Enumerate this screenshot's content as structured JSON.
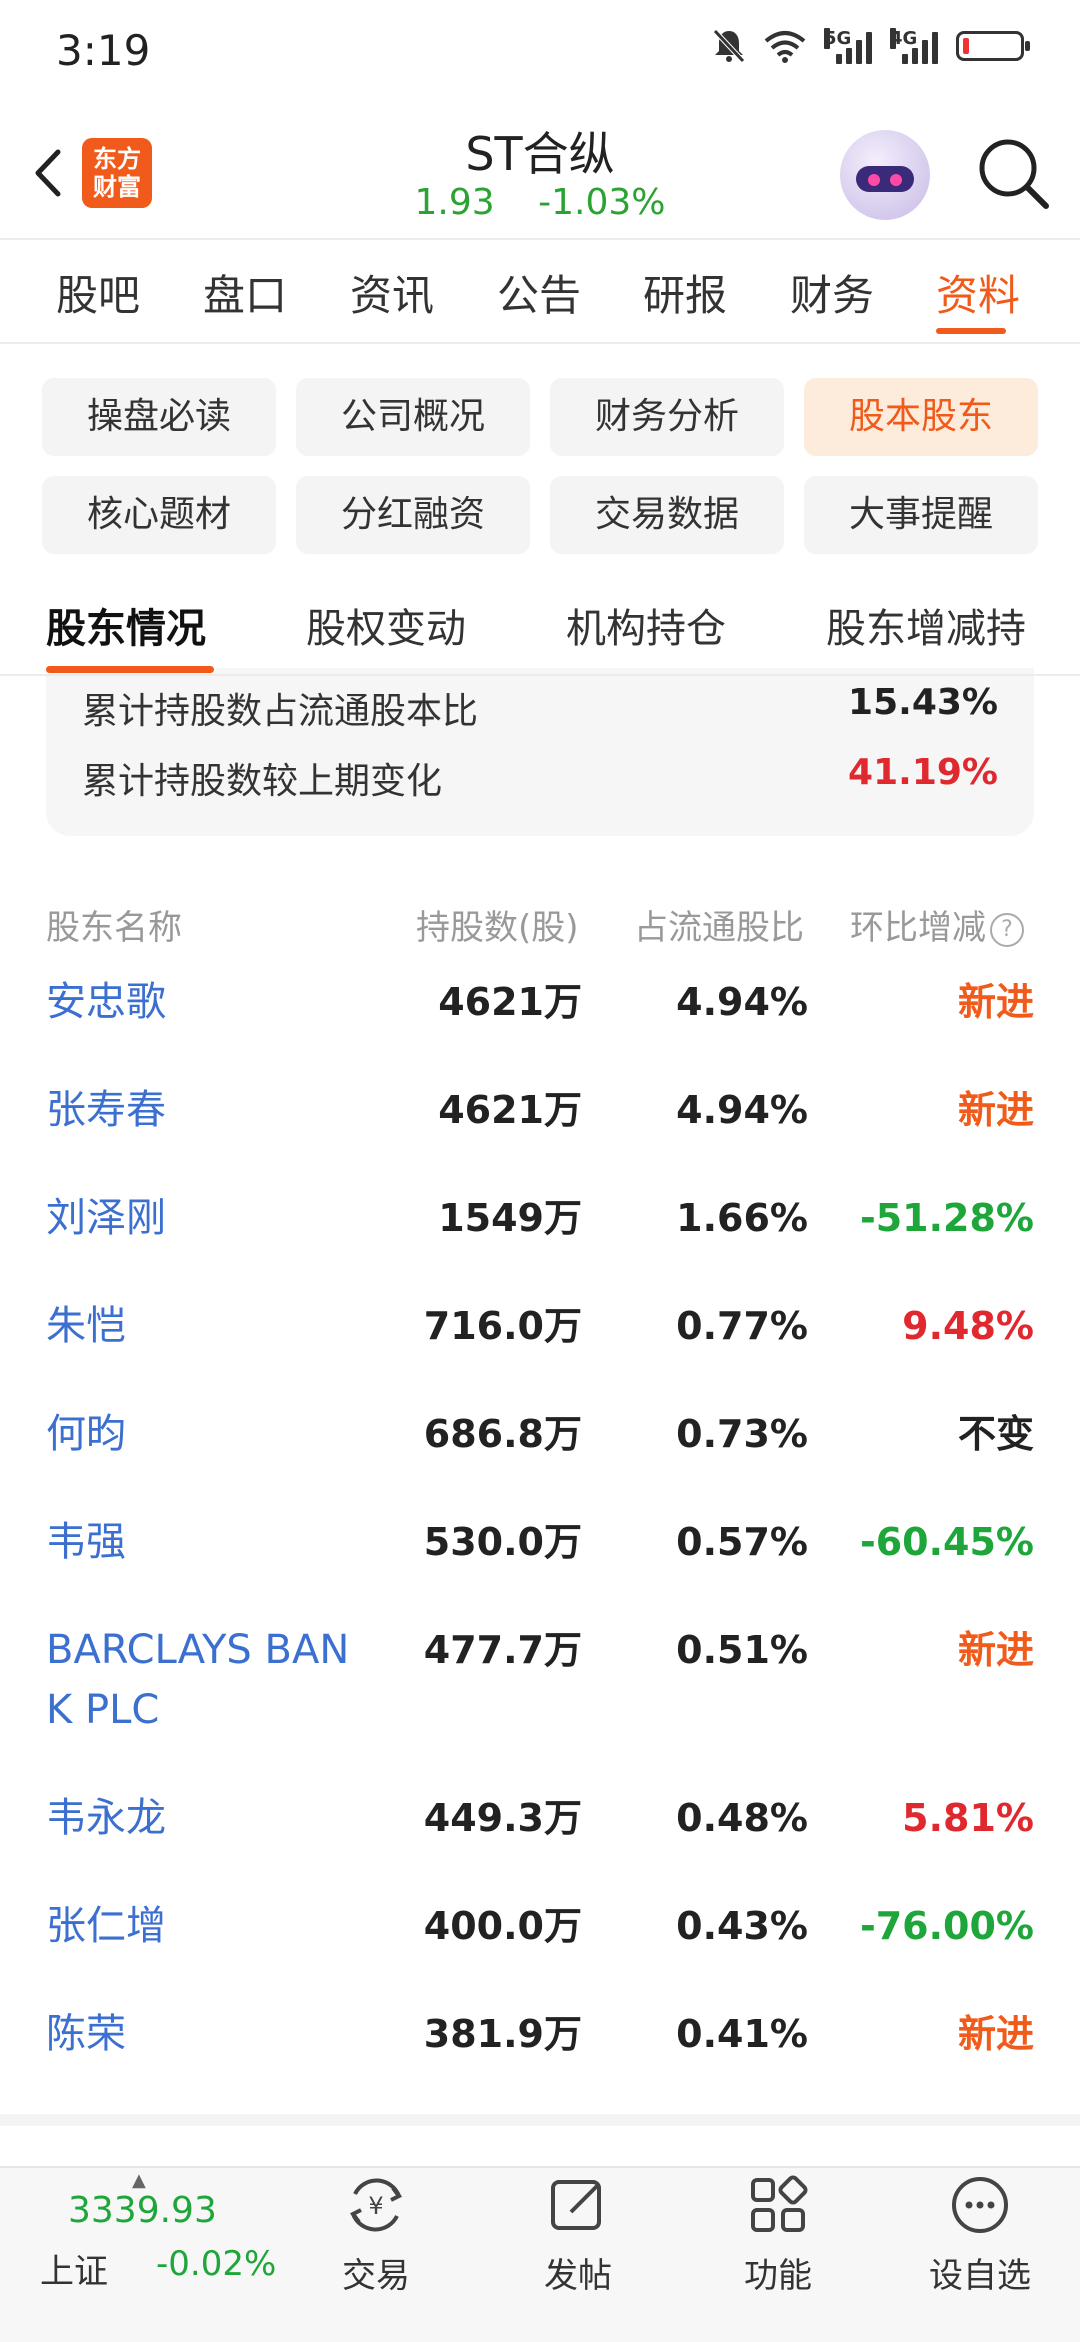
{
  "status_bar": {
    "time": "3:19",
    "signal1": "5G",
    "signal2": "4G"
  },
  "header": {
    "logo_text": "东方财富",
    "title": "ST合纵",
    "price": "1.93",
    "change": "-1.03%"
  },
  "main_tabs": [
    "股吧",
    "盘口",
    "资讯",
    "公告",
    "研报",
    "财务",
    "资料"
  ],
  "active_main_tab": "资料",
  "chips": [
    "操盘必读",
    "公司概况",
    "财务分析",
    "股本股东",
    "核心题材",
    "分红融资",
    "交易数据",
    "大事提醒"
  ],
  "active_chip": "股本股东",
  "sub_tabs": [
    "股东情况",
    "股权变动",
    "机构持仓",
    "股东增减持"
  ],
  "summary": [
    {
      "label": "累计持股数占流通股本比",
      "value": "15.43%"
    },
    {
      "label": "累计持股数较上期变化",
      "value": "41.19%"
    }
  ],
  "table": {
    "headers": [
      "股东名称",
      "持股数(股)",
      "占流通股比",
      "环比增减"
    ],
    "help_icon": "?",
    "rows": [
      {
        "name": "安忠歌",
        "shares": "4621万",
        "ratio": "4.94%",
        "change": "新进",
        "tone": "orange"
      },
      {
        "name": "张寿春",
        "shares": "4621万",
        "ratio": "4.94%",
        "change": "新进",
        "tone": "orange"
      },
      {
        "name": "刘泽刚",
        "shares": "1549万",
        "ratio": "1.66%",
        "change": "-51.28%",
        "tone": "green"
      },
      {
        "name": "朱恺",
        "shares": "716.0万",
        "ratio": "0.77%",
        "change": "9.48%",
        "tone": "red"
      },
      {
        "name": "何昀",
        "shares": "686.8万",
        "ratio": "0.73%",
        "change": "不变",
        "tone": "black"
      },
      {
        "name": "韦强",
        "shares": "530.0万",
        "ratio": "0.57%",
        "change": "-60.45%",
        "tone": "green"
      },
      {
        "name": "BARCLAYS BANK PLC",
        "name_line1": "BARCLAYS BAN",
        "name_line2": "K PLC",
        "shares": "477.7万",
        "ratio": "0.51%",
        "change": "新进",
        "tone": "orange"
      },
      {
        "name": "韦永龙",
        "shares": "449.3万",
        "ratio": "0.48%",
        "change": "5.81%",
        "tone": "red"
      },
      {
        "name": "张仁增",
        "shares": "400.0万",
        "ratio": "0.43%",
        "change": "-76.00%",
        "tone": "green"
      },
      {
        "name": "陈荣",
        "shares": "381.9万",
        "ratio": "0.41%",
        "change": "新进",
        "tone": "orange"
      }
    ]
  },
  "bottom_bar": {
    "index_value": "3339.93",
    "index_name": "上证",
    "index_change": "-0.02%",
    "nav": [
      {
        "label": "交易",
        "icon": "yen-cycle-icon"
      },
      {
        "label": "发帖",
        "icon": "edit-icon"
      },
      {
        "label": "功能",
        "icon": "grid-icon"
      },
      {
        "label": "设自选",
        "icon": "more-icon"
      }
    ]
  },
  "colors": {
    "accent": "#f05a1a",
    "up": "#e0282f",
    "down": "#1ea63a",
    "link": "#3b6fd0"
  }
}
